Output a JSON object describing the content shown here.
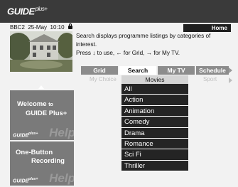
{
  "brand": {
    "logo_main": "GUIDE",
    "logo_plus": "plus+"
  },
  "status": {
    "channel": "BBC2",
    "date": "25-May",
    "time": "10:10"
  },
  "home_button": "Home",
  "help_text": {
    "line1": "Search displays programme listings by categories of interest.",
    "line2": "Press ↓ to use, ← for Grid, → for My TV."
  },
  "tabs": [
    {
      "label": "Grid",
      "active": false
    },
    {
      "label": "Search",
      "active": true
    },
    {
      "label": "My TV",
      "active": false
    },
    {
      "label": "Schedule",
      "active": false
    }
  ],
  "subnav": {
    "left": "My Choice",
    "right": "Sport"
  },
  "category": {
    "header": "Movies",
    "items": [
      "All",
      "Action",
      "Animation",
      "Comedy",
      "Drama",
      "Romance",
      "Sci Fi",
      "Thriller"
    ]
  },
  "panels": {
    "welcome": {
      "line1_pre": "Welcome",
      "line1_to": "to",
      "line2": "GUIDE Plus+",
      "watermark": "Help"
    },
    "recording": {
      "line1": "One-Button",
      "line2": "Recording",
      "watermark": "Help"
    }
  },
  "icons": {
    "lock": "lock-icon",
    "tab_more": "chevron-right-icon",
    "scroll_up": "chevron-up-icon"
  },
  "colors": {
    "topbar": "#3a3a3a",
    "list_item": "#242424",
    "tab_inactive": "#8c8c8c"
  }
}
